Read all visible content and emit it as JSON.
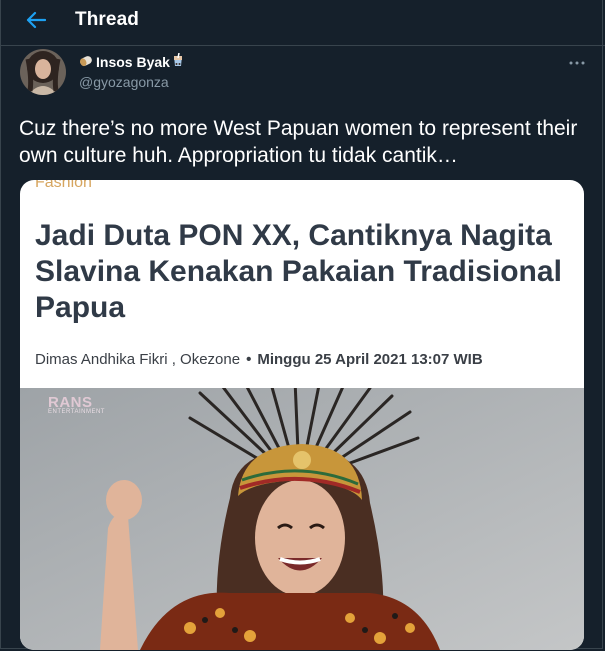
{
  "header": {
    "title": "Thread",
    "back_icon": "arrow-left-icon"
  },
  "author": {
    "name": "Insos Byak",
    "name_prefix_icon": "pill-emoji-icon",
    "name_suffix_icon": "bubble-tea-emoji-icon",
    "handle": "@gyozagonza"
  },
  "tweet": {
    "text": "Cuz there’s no more West Papuan women to represent their own culture huh. Appropriation tu tidak cantik…"
  },
  "card": {
    "section": "Fashion",
    "headline": "Jadi Duta PON XX, Cantiknya Nagita Slavina Kenakan Pakaian Tradisional Papua",
    "author": "Dimas Andhika Fikri , Okezone",
    "separator": "•",
    "date": "Minggu 25 April 2021 13:07 WIB",
    "logo_text": "RANS",
    "logo_sub": "ENTERTAINMENT"
  },
  "colors": {
    "accent": "#1da1f2",
    "background": "#15202b",
    "muted": "#8899a6",
    "border": "#38444d"
  }
}
